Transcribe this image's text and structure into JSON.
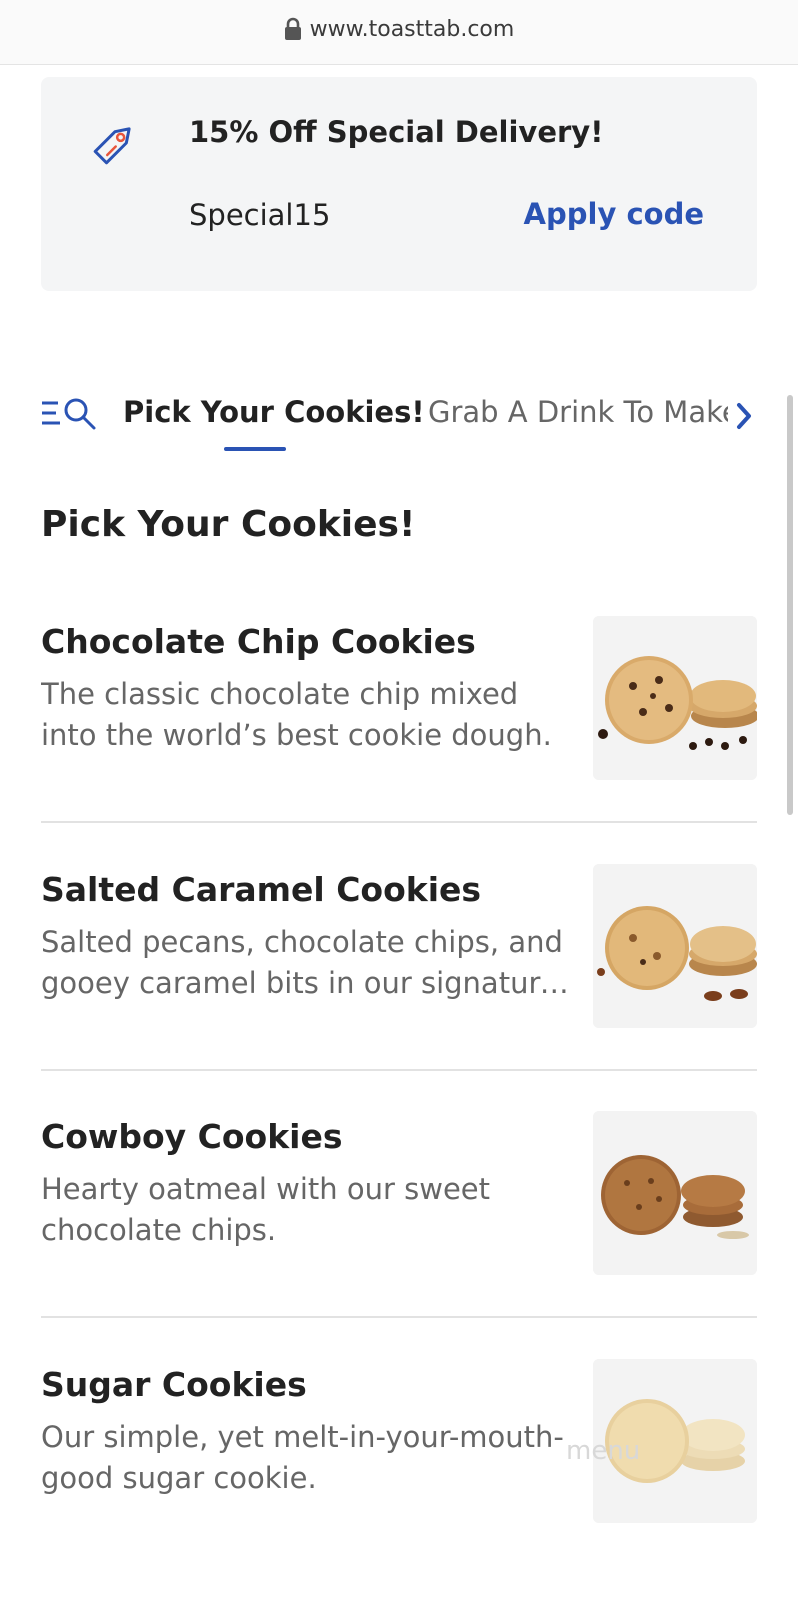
{
  "browser": {
    "url": "www.toasttab.com",
    "lock_icon": "lock-icon"
  },
  "promo": {
    "icon": "tag-icon",
    "title": "15% Off Special Delivery!",
    "code": "Special15",
    "apply_label": "Apply code",
    "accent_color": "#2a53b4"
  },
  "tabs": {
    "search_icon": "menu-search-icon",
    "items": [
      {
        "label": "Pick Your Cookies!",
        "active": true
      },
      {
        "label": "Grab A Drink To Make It",
        "active": false
      }
    ],
    "next_icon": "chevron-right-icon"
  },
  "section": {
    "title": "Pick Your Cookies!"
  },
  "menu_items": [
    {
      "name": "Chocolate Chip Cookies",
      "description": "The classic chocolate chip mixed into the world’s best cookie dough."
    },
    {
      "name": "Salted Caramel Cookies",
      "description": "Salted pecans, chocolate chips, and gooey caramel bits in our signature cookie dough."
    },
    {
      "name": "Cowboy Cookies",
      "description": "Hearty oatmeal with our sweet chocolate chips."
    },
    {
      "name": "Sugar Cookies",
      "description": "Our simple, yet melt-in-your-mouth-good sugar cookie."
    }
  ],
  "watermark": "menu"
}
